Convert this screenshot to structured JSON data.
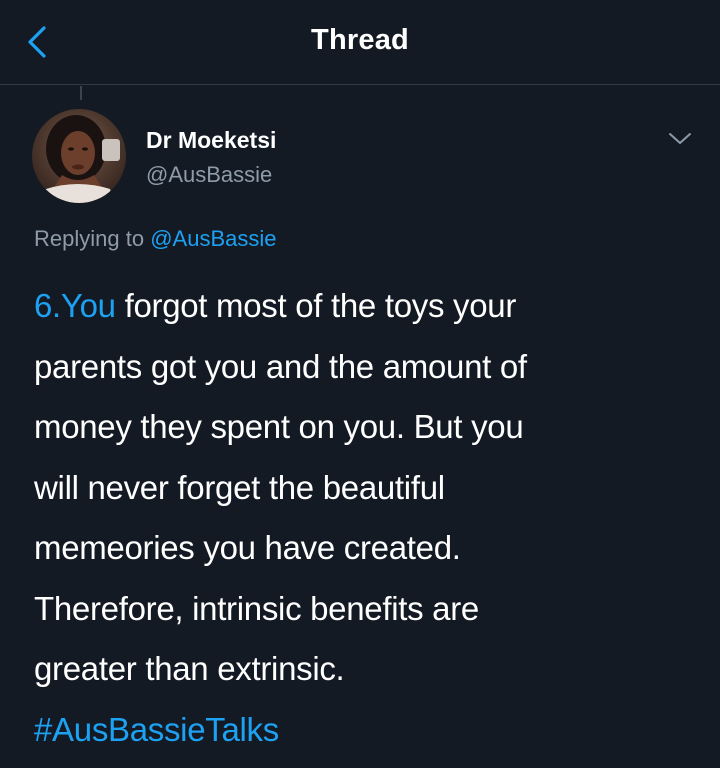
{
  "header": {
    "title": "Thread",
    "back_icon": "chevron-left-icon"
  },
  "author": {
    "name": "Dr Moeketsi",
    "handle": "@AusBassie",
    "menu_icon": "chevron-down-icon"
  },
  "reply": {
    "prefix": "Replying to",
    "mention": "@AusBassie"
  },
  "tweet": {
    "number_link": "6.You",
    "lines": [
      " forgot most of the toys your",
      "parents got you and the amount of",
      "money they spent on you. But you",
      "will never forget the beautiful",
      "memeories you have created.",
      "Therefore, intrinsic benefits are",
      "greater than extrinsic."
    ],
    "hashtag": "#AusBassieTalks"
  },
  "colors": {
    "background": "#141a24",
    "accent": "#1da1f2",
    "secondary_text": "#8e9ba8"
  }
}
